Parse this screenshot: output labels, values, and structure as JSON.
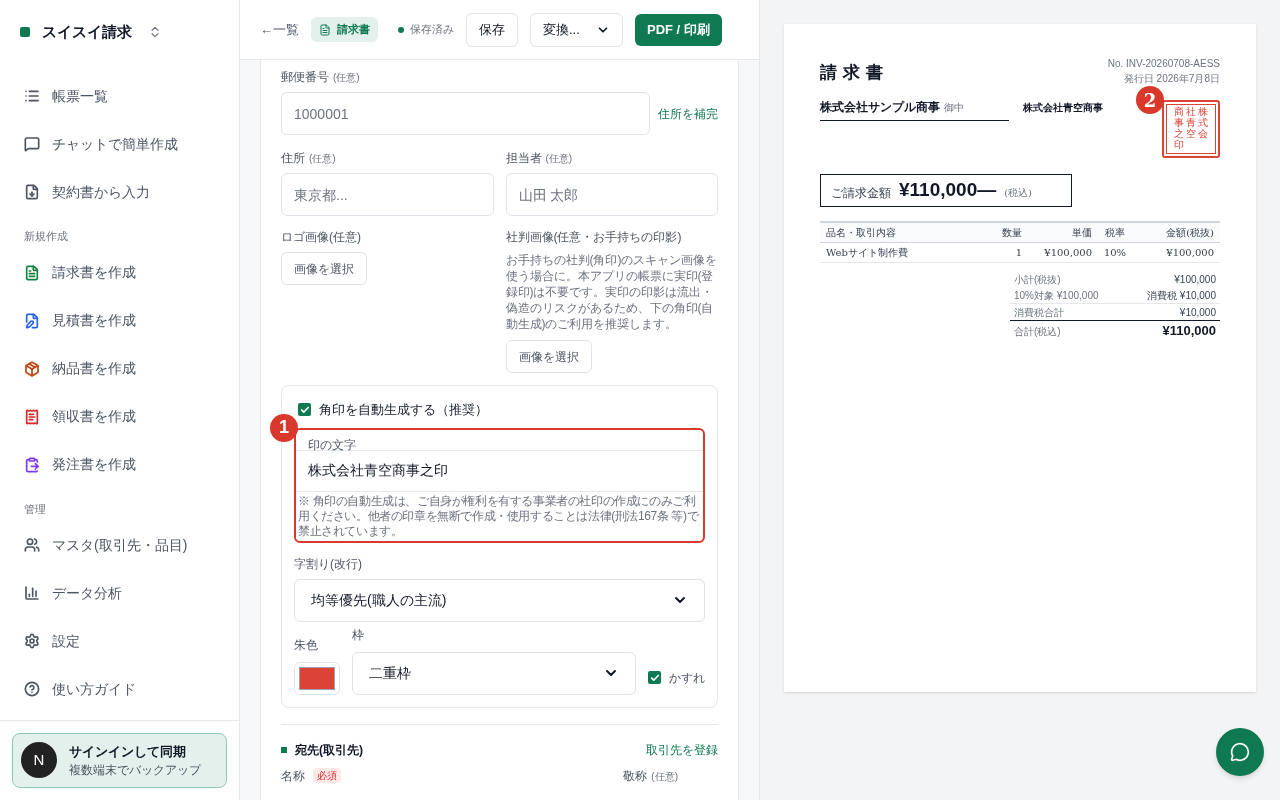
{
  "sidebar": {
    "brand": "スイスイ請求",
    "sections": [
      {
        "items": [
          {
            "label": "帳票一覧"
          },
          {
            "label": "チャットで簡単作成"
          },
          {
            "label": "契約書から入力"
          }
        ]
      },
      {
        "heading": "新規作成",
        "items": [
          {
            "label": "請求書を作成",
            "color": "#15803d"
          },
          {
            "label": "見積書を作成",
            "color": "#2563eb"
          },
          {
            "label": "納品書を作成",
            "color": "#c2410c"
          },
          {
            "label": "領収書を作成",
            "color": "#dc2626"
          },
          {
            "label": "発注書を作成",
            "color": "#7c3aed"
          }
        ]
      },
      {
        "heading": "管理",
        "items": [
          {
            "label": "マスタ(取引先・品目)"
          },
          {
            "label": "データ分析"
          },
          {
            "label": "設定"
          },
          {
            "label": "使い方ガイド"
          }
        ]
      }
    ],
    "signin": {
      "avatar": "N",
      "title": "サインインして同期",
      "subtitle": "複数端末でバックアップ"
    }
  },
  "header": {
    "back": "←一覧",
    "doc_badge": "請求書",
    "saved_status": "保存済み",
    "save_button": "保存",
    "convert_select": "変換...",
    "pdf_button": "PDF / 印刷"
  },
  "form": {
    "postal": {
      "label": "郵便番号",
      "optional": "(任意)",
      "placeholder": "1000001",
      "action": "住所を補完"
    },
    "address": {
      "label": "住所",
      "optional": "(任意)",
      "placeholder": "東京都..."
    },
    "contact": {
      "label": "担当者",
      "optional": "(任意)",
      "placeholder": "山田 太郎"
    },
    "logo": {
      "label": "ロゴ画像(任意)",
      "button": "画像を選択"
    },
    "seal": {
      "label": "社判画像(任意・お手持ちの印影)",
      "description": "お手持ちの社判(角印)のスキャン画像を使う場合に。本アプリの帳票に実印(登録印)は不要です。実印の印影は流出・偽造のリスクがあるため、下の角印(自動生成)のご利用を推奨します。",
      "button": "画像を選択"
    },
    "auto_seal": {
      "label": "角印を自動生成する（推奨）",
      "checked": true,
      "text_label": "印の文字",
      "value": "株式会社青空商事之印",
      "notice": "※ 角印の自動生成は、ご自身が権利を有する事業者の社印の作成にのみご利用ください。他者の印章を無断で作成・使用することは法律(刑法167条 等)で禁止されています。",
      "layout_label": "字割り(改行)",
      "layout_value": "均等優先(職人の主流)",
      "color_label": "朱色",
      "color": "#dc4236",
      "frame_label": "枠",
      "frame_value": "二重枠",
      "blur_label": "かすれ",
      "blur_checked": true
    },
    "recipient": {
      "title": "宛先(取引先)",
      "action": "取引先を登録",
      "name_label": "名称",
      "required": "必須",
      "honorific_label": "敬称",
      "honorific_optional": "(任意)"
    }
  },
  "annotations": [
    {
      "number": "1"
    },
    {
      "number": "2"
    }
  ],
  "preview": {
    "title": "請 求 書",
    "number": "No. INV-20260708-AESS",
    "date": "発行日 2026年7月8日",
    "client": "株式会社サンプル商事",
    "client_suffix": "御中",
    "issuer": "株式会社青空商事",
    "stamp_columns": [
      "商事之印",
      "社青空",
      "株式会"
    ],
    "amount_label": "ご請求金額",
    "amount": "¥110,000—",
    "amount_suffix": "(税込)",
    "columns": [
      "品名・取引内容",
      "数量",
      "単価",
      "税率",
      "金額(税抜)"
    ],
    "rows": [
      [
        "Webサイト制作費",
        "1",
        "¥100,000",
        "10%",
        "¥100,000"
      ]
    ],
    "subtotal": {
      "label": "小計(税抜)",
      "value": "¥100,000"
    },
    "tax_target": {
      "label": "10%対象 ¥100,000",
      "value": "消費税 ¥10,000"
    },
    "tax_total": {
      "label": "消費税合計",
      "value": "¥10,000"
    },
    "total": {
      "label": "合計(税込)",
      "value": "¥110,000"
    }
  }
}
